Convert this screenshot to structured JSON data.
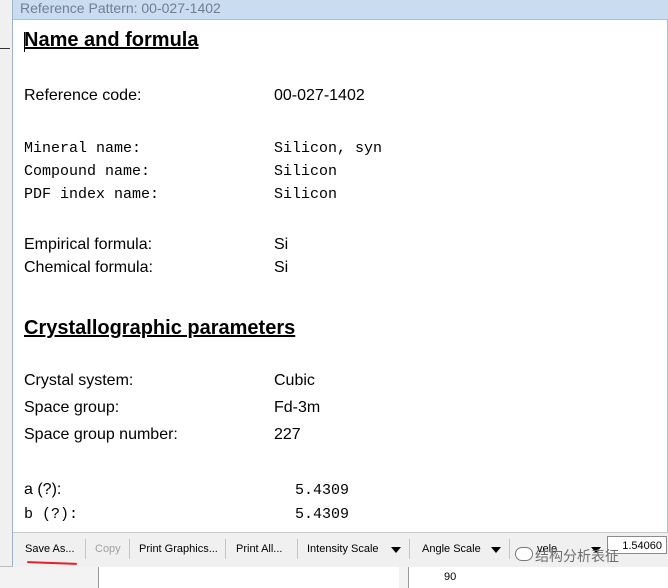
{
  "window": {
    "title": "Reference Pattern: 00-027-1402"
  },
  "sections": {
    "name_formula": {
      "heading": "Name and formula",
      "reference_code": {
        "label": "Reference code:",
        "value": "00-027-1402"
      },
      "mineral_name": {
        "label": "Mineral name:",
        "value": "Silicon, syn"
      },
      "compound_name": {
        "label": "Compound name:",
        "value": "Silicon"
      },
      "pdf_index_name": {
        "label": "PDF index name:",
        "value": "Silicon"
      },
      "empirical_formula": {
        "label": "Empirical formula:",
        "value": "Si"
      },
      "chemical_formula": {
        "label": "Chemical formula:",
        "value": "Si"
      }
    },
    "crystallographic": {
      "heading": "Crystallographic parameters",
      "crystal_system": {
        "label": "Crystal system:",
        "value": "Cubic"
      },
      "space_group": {
        "label": "Space group:",
        "value": "Fd-3m"
      },
      "space_group_number": {
        "label": "Space group number:",
        "value": "227"
      },
      "a": {
        "label": "a (?):",
        "value": "5.4309"
      },
      "b": {
        "label": "b (?):",
        "value": "5.4309"
      }
    }
  },
  "toolbar": {
    "save_as": "Save As...",
    "copy": "Copy",
    "print_graphics": "Print Graphics...",
    "print_all": "Print All...",
    "intensity_scale": "Intensity Scale",
    "angle_scale": "Angle Scale",
    "wavelength_partial": "vele",
    "wavelength_value": "1.54060",
    "watermark": "结构分析表征"
  },
  "background": {
    "axis_value": "90"
  },
  "colors": {
    "titlebar": "#c9dcf0",
    "annotation_red": "#e0202a"
  }
}
